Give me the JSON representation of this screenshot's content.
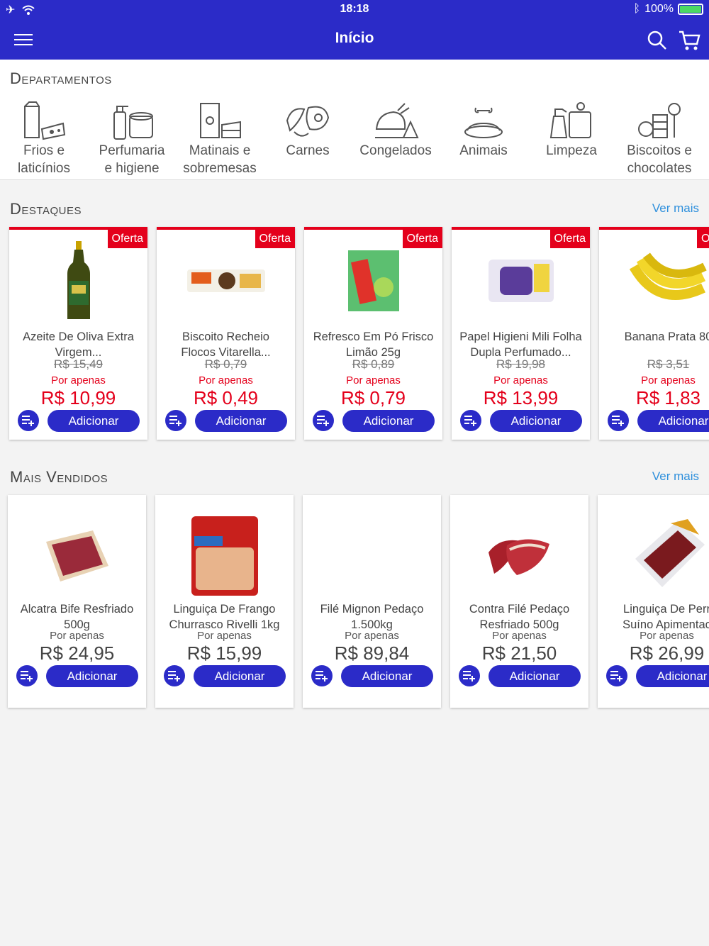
{
  "status_bar": {
    "time": "18:18",
    "battery": "100%"
  },
  "header": {
    "title": "Início"
  },
  "departments": {
    "title": "Departamentos",
    "items": [
      {
        "label": "Frios e\nlaticínios",
        "icon": "dairy-icon"
      },
      {
        "label": "Perfumaria\ne higiene",
        "icon": "hygiene-icon"
      },
      {
        "label": "Matinais e\nsobremesas",
        "icon": "breakfast-icon"
      },
      {
        "label": "Carnes",
        "icon": "meat-icon"
      },
      {
        "label": "Congelados",
        "icon": "frozen-icon"
      },
      {
        "label": "Animais",
        "icon": "pet-icon"
      },
      {
        "label": "Limpeza",
        "icon": "cleaning-icon"
      },
      {
        "label": "Biscoitos e\nchocolates",
        "icon": "sweets-icon"
      }
    ]
  },
  "highlights": {
    "title": "Destaques",
    "more_label": "Ver mais",
    "badge_label": "Oferta",
    "items": [
      {
        "name": "Azeite De Oliva Extra\nVirgem...",
        "old_price": "R$ 15,49",
        "lead": "Por apenas",
        "price": "R$ 10,99",
        "add": "Adicionar"
      },
      {
        "name": "Biscoito Recheio\nFlocos Vitarella...",
        "old_price": "R$ 0,79",
        "lead": "Por apenas",
        "price": "R$ 0,49",
        "add": "Adicionar"
      },
      {
        "name": "Refresco Em Pó Frisco\nLimão 25g",
        "old_price": "R$ 0,89",
        "lead": "Por apenas",
        "price": "R$ 0,79",
        "add": "Adicionar"
      },
      {
        "name": "Papel Higieni Mili Folha\nDupla Perfumado...",
        "old_price": "R$ 19,98",
        "lead": "Por apenas",
        "price": "R$ 13,99",
        "add": "Adicionar"
      },
      {
        "name": "Banana Prata 80",
        "old_price": "R$ 3,51",
        "lead": "Por apenas",
        "price": "R$ 1,83",
        "add": "Adicionar"
      }
    ]
  },
  "bestsellers": {
    "title": "Mais Vendidos",
    "more_label": "Ver mais",
    "items": [
      {
        "name": "Alcatra Bife Resfriado\n500g",
        "lead": "Por apenas",
        "price": "R$ 24,95",
        "add": "Adicionar"
      },
      {
        "name": "Linguiça De Frango\nChurrasco Rivelli 1kg",
        "lead": "Por apenas",
        "price": "R$ 15,99",
        "add": "Adicionar"
      },
      {
        "name": "Filé Mignon Pedaço\n1.500kg",
        "lead": "Por apenas",
        "price": "R$ 89,84",
        "add": "Adicionar"
      },
      {
        "name": "Contra Filé Pedaço\nResfriado 500g",
        "lead": "Por apenas",
        "price": "R$ 21,50",
        "add": "Adicionar"
      },
      {
        "name": "Linguiça De Perr\nSuíno Apimentac",
        "lead": "Por apenas",
        "price": "R$ 26,99",
        "add": "Adicionar"
      }
    ]
  },
  "colors": {
    "primary": "#2b2bc8",
    "offer": "#e4001b",
    "link": "#2d8fdc"
  }
}
